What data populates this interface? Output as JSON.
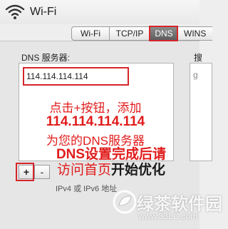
{
  "window": {
    "title": "Wi-Fi",
    "icon": "wifi-icon"
  },
  "tabs": [
    {
      "label": "Wi-Fi"
    },
    {
      "label": "TCP/IP"
    },
    {
      "label": "DNS",
      "selected": true
    },
    {
      "label": "WINS"
    }
  ],
  "dns": {
    "label": "DNS 服务器:",
    "servers": [
      "114.114.114.114"
    ]
  },
  "search_domains": {
    "label": "搜",
    "value": "g"
  },
  "buttons": {
    "add_label": "+",
    "remove_label": "-"
  },
  "hint": "IPv4 或 IPv6 地址",
  "instructions": {
    "line1": "点击+按钮，添加",
    "line2": "114.114.114.114",
    "line3": "为您的DNS服务器"
  },
  "overlay_notice": {
    "line1": "DNS设置完成后请",
    "line2_a": "访问首页",
    "line2_b": "开始优化"
  },
  "watermark": {
    "name": "绿茶软件园",
    "url": "www.33LC.com"
  },
  "colors": {
    "highlight": "#d6252b",
    "instruction_text": "#e11b1b",
    "selected_tab": "#6e6e6e"
  }
}
